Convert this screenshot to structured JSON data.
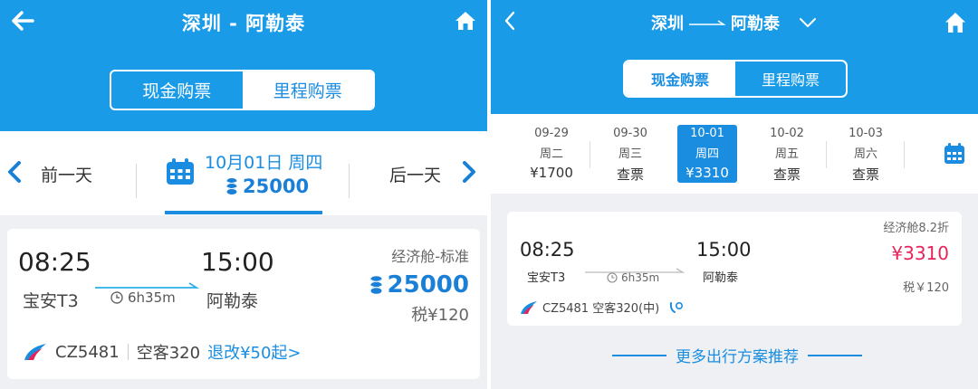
{
  "left": {
    "header": {
      "title": "深圳 - 阿勒泰"
    },
    "tabs": {
      "cash": "现金购票",
      "miles": "里程购票"
    },
    "datebar": {
      "prev": "前一天",
      "next": "后一天",
      "date": "10月01日 周四",
      "miles_price": "25000"
    },
    "flight": {
      "dep_time": "08:25",
      "arr_time": "15:00",
      "dep_airport": "宝安T3",
      "arr_airport": "阿勒泰",
      "duration": "6h35m",
      "cabin": "经济舱-标准",
      "price": "25000",
      "tax": "税¥120",
      "flight_no": "CZ5481",
      "aircraft": "空客320",
      "refund": "退改¥50起>"
    },
    "colors": {
      "brand": "#1a9be8",
      "accent": "#1a8de0"
    }
  },
  "right": {
    "header": {
      "from": "深圳",
      "to": "阿勒泰"
    },
    "tabs": {
      "cash": "现金购票",
      "miles": "里程购票"
    },
    "days": [
      {
        "date": "09-29",
        "weekday": "周二",
        "price": "¥1700"
      },
      {
        "date": "09-30",
        "weekday": "周三",
        "price": "查票"
      },
      {
        "date": "10-01",
        "weekday": "周四",
        "price": "¥3310"
      },
      {
        "date": "10-02",
        "weekday": "周五",
        "price": "查票"
      },
      {
        "date": "10-03",
        "weekday": "周六",
        "price": "查票"
      }
    ],
    "flight": {
      "cabin": "经济舱8.2折",
      "dep_time": "08:25",
      "arr_time": "15:00",
      "dep_airport": "宝安T3",
      "arr_airport": "阿勒泰",
      "duration": "6h35m",
      "price": "¥3310",
      "tax": "税￥120",
      "flight_info": "CZ5481 空客320(中)"
    },
    "more": "更多出行方案推荐",
    "colors": {
      "brand": "#1a9be8",
      "price": "#e6245a"
    }
  }
}
